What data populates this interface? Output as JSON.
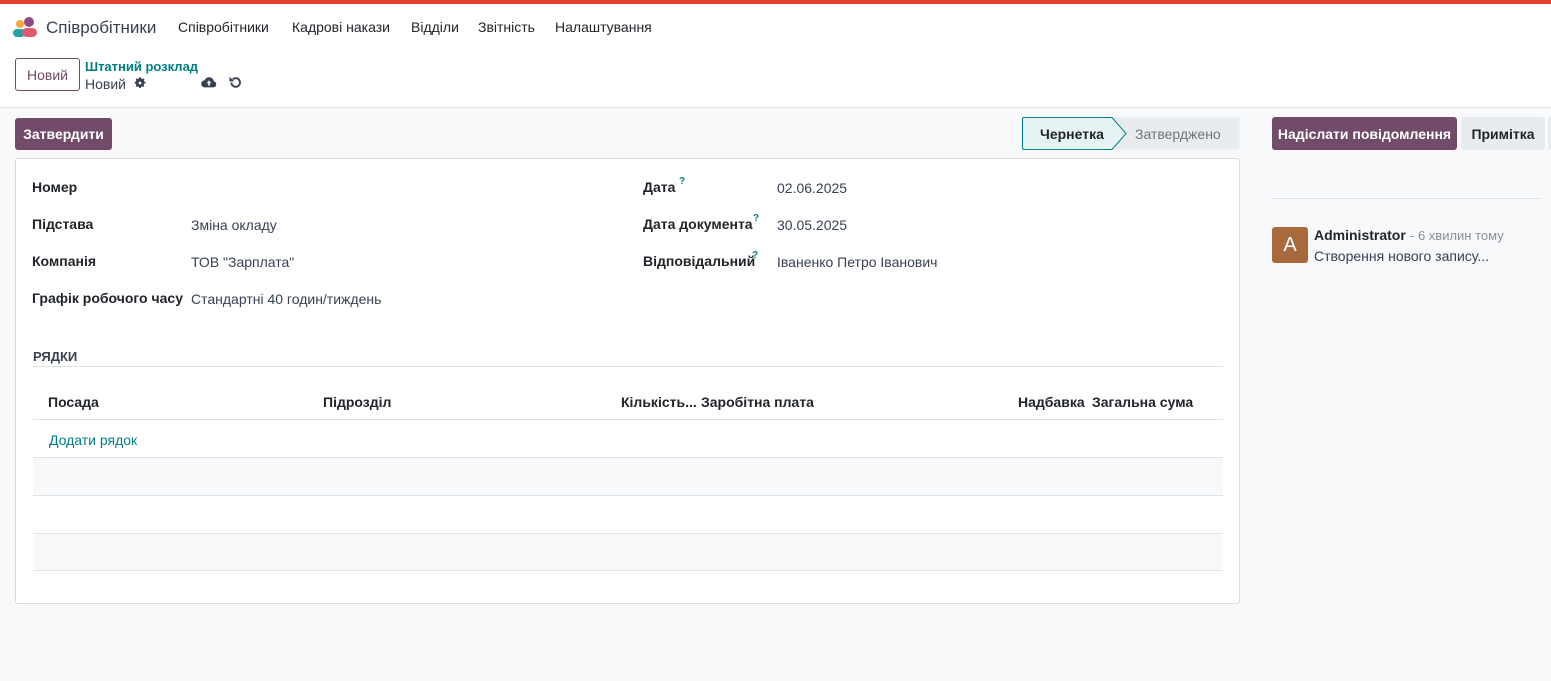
{
  "app": {
    "name": "Співробітники"
  },
  "menu": [
    "Співробітники",
    "Кадрові накази",
    "Відділи",
    "Звітність",
    "Налаштування"
  ],
  "control": {
    "new_label": "Новий",
    "breadcrumb": "Штатний розклад",
    "record_name": "Новий"
  },
  "actions": {
    "approve_label": "Затвердити"
  },
  "statusbar": {
    "stages": [
      "Чернетка",
      "Затверджено"
    ],
    "current": "Чернетка"
  },
  "form": {
    "left": [
      {
        "label": "Номер",
        "value": ""
      },
      {
        "label": "Підстава",
        "value": "Зміна окладу"
      },
      {
        "label": "Компанія",
        "value": "ТОВ \"Зарплата\""
      },
      {
        "label": "Графік робочого часу",
        "value": "Стандартні 40 годин/тиждень"
      }
    ],
    "right": [
      {
        "label": "Дата",
        "help": "?",
        "value": "02.06.2025"
      },
      {
        "label": "Дата документа",
        "help": "?",
        "value": "30.05.2025"
      },
      {
        "label": "Відповідальний",
        "help": "?",
        "value": "Іваненко Петро Іванович"
      }
    ]
  },
  "lines": {
    "title": "РЯДКИ",
    "columns": [
      "Посада",
      "Підрозділ",
      "Кількість...",
      "Заробітна плата",
      "Надбавка",
      "Загальна сума"
    ],
    "add_line_label": "Додати рядок"
  },
  "chatter": {
    "send_message_label": "Надіслати повідомлення",
    "note_label": "Примітка",
    "messages": [
      {
        "avatar_letter": "A",
        "author": "Administrator",
        "time": "- 6 хвилин тому",
        "body": "Створення нового запису..."
      }
    ]
  },
  "colors": {
    "brand": "#714b67",
    "link": "#017e84",
    "top_strip": "#e0442e",
    "avatar": "#a86a3d"
  }
}
